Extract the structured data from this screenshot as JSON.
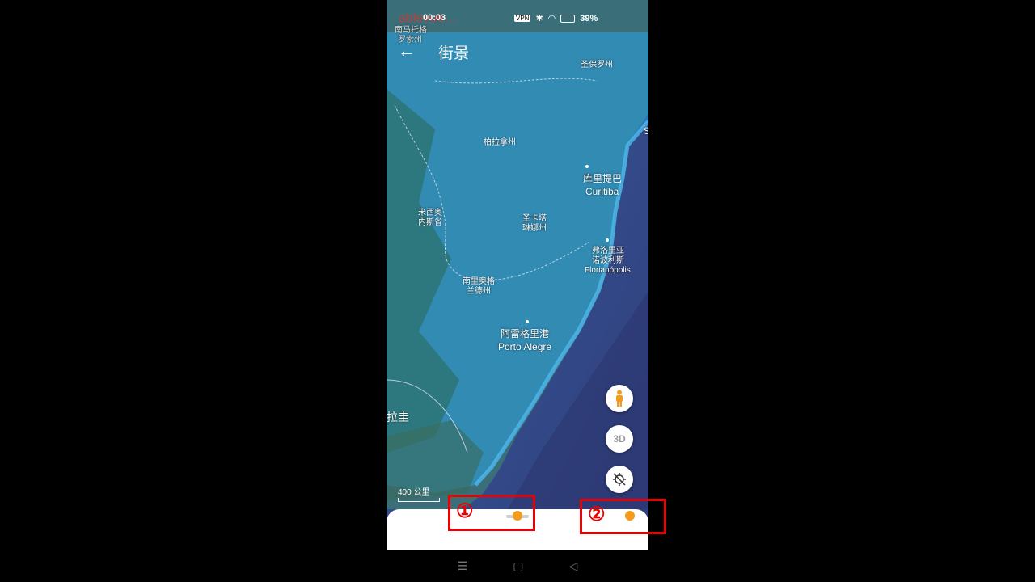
{
  "status_bar": {
    "time": "00:03",
    "vpn": "VPN",
    "battery": "39%"
  },
  "overlay_text": {
    "line1": "ablevue…",
    "line2": "南马托格",
    "line3": "罗索州"
  },
  "header": {
    "back_icon": "arrow-left-icon",
    "title": "街景"
  },
  "map": {
    "labels": {
      "sao_paulo": "圣保罗州",
      "parana": "柏拉拿州",
      "curitiba_cn": "库里提巴",
      "curitiba_en": "Curitiba",
      "misiones_1": "米西奥",
      "misiones_2": "内斯省",
      "santa_catarina_1": "圣卡塔",
      "santa_catarina_2": "琳娜州",
      "florianopolis_cn_1": "弗洛里亚",
      "florianopolis_cn_2": "诺波利斯",
      "florianopolis_en": "Florianópolis",
      "rs_1": "南里奥格",
      "rs_2": "兰德州",
      "porto_alegre_cn": "阿雷格里港",
      "porto_alegre_en": "Porto Alegre",
      "uruguay": "拉圭",
      "edge_s": "S"
    },
    "scale": "400 公里"
  },
  "buttons": {
    "pegman": "pegman-icon",
    "three_d": "3D",
    "compass": "compass-crossed-icon"
  },
  "annotations": {
    "one": "①",
    "two": "②"
  },
  "nav": {
    "menu": "☰",
    "home": "▢",
    "back": "◁"
  },
  "colors": {
    "water": "#3b4a8c",
    "coverage": "#29a3e0",
    "accent": "#f29b1d"
  }
}
